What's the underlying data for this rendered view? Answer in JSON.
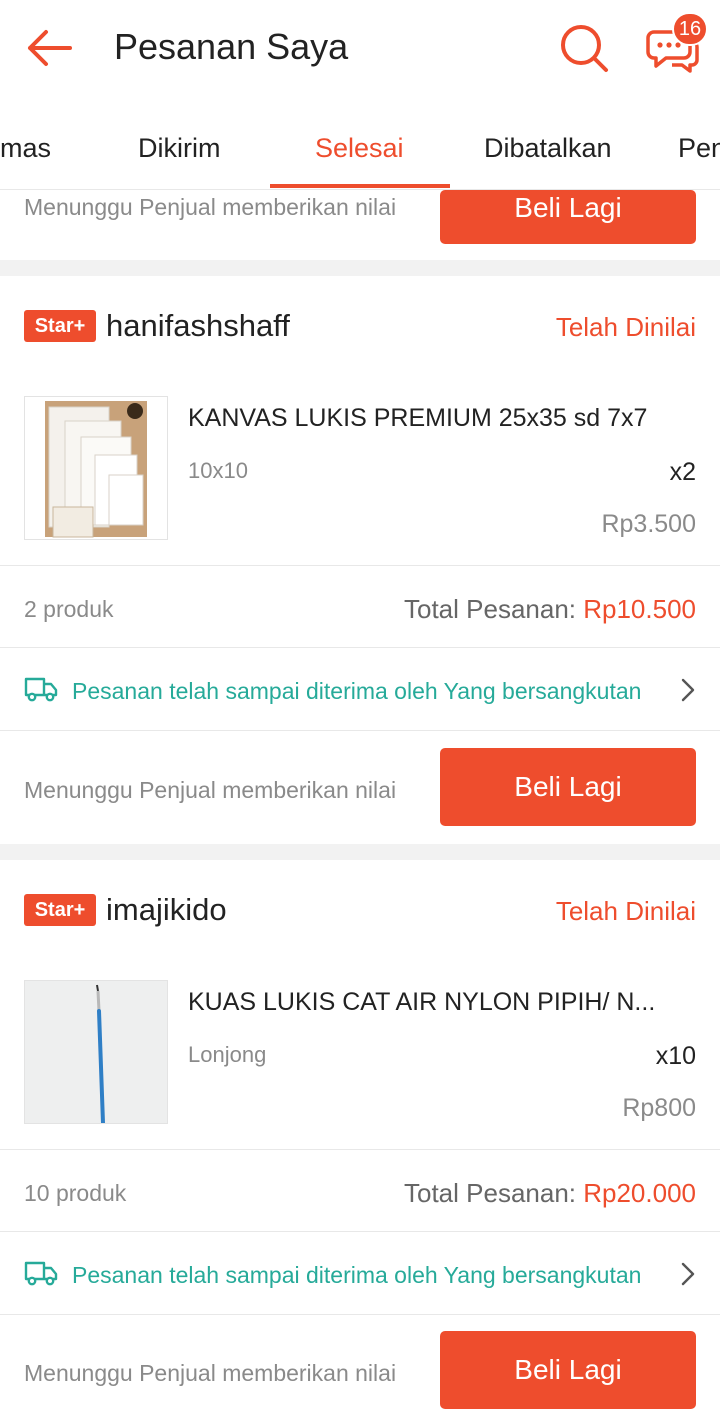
{
  "header": {
    "title": "Pesanan Saya",
    "chat_badge": "16"
  },
  "tabs": [
    {
      "label": "mas",
      "active": false
    },
    {
      "label": "Dikirim",
      "active": false
    },
    {
      "label": "Selesai",
      "active": true
    },
    {
      "label": "Dibatalkan",
      "active": false
    },
    {
      "label": "Pen",
      "active": false
    }
  ],
  "top_partial": {
    "status": "Menunggu Penjual memberikan nilai",
    "button": "Beli Lagi"
  },
  "orders": [
    {
      "badge": "Star+",
      "shop": "hanifashshaff",
      "review_status": "Telah Dinilai",
      "product": {
        "name": "KANVAS LUKIS PREMIUM 25x35 sd 7x7",
        "variant": "10x10",
        "qty": "x2",
        "price": "Rp3.500"
      },
      "count": "2 produk",
      "total_label": "Total Pesanan: ",
      "total_amount": "Rp10.500",
      "shipping": "Pesanan telah sampai diterima oleh Yang bersangkutan",
      "status": "Menunggu Penjual memberikan nilai",
      "button": "Beli Lagi"
    },
    {
      "badge": "Star+",
      "shop": "imajikido",
      "review_status": "Telah Dinilai",
      "product": {
        "name": "KUAS LUKIS CAT AIR NYLON PIPIH/ N...",
        "variant": "Lonjong",
        "qty": "x10",
        "price": "Rp800"
      },
      "count": "10 produk",
      "total_label": "Total Pesanan: ",
      "total_amount": "Rp20.000",
      "shipping": "Pesanan telah sampai diterima oleh Yang bersangkutan",
      "status": "Menunggu Penjual memberikan nilai",
      "button": "Beli Lagi"
    }
  ],
  "colors": {
    "accent": "#ee4d2d",
    "shipping_green": "#26aa99",
    "muted_text": "#8a8a8a"
  },
  "icons": [
    "back-arrow-icon",
    "search-icon",
    "chat-icon",
    "truck-icon",
    "chevron-right-icon"
  ]
}
